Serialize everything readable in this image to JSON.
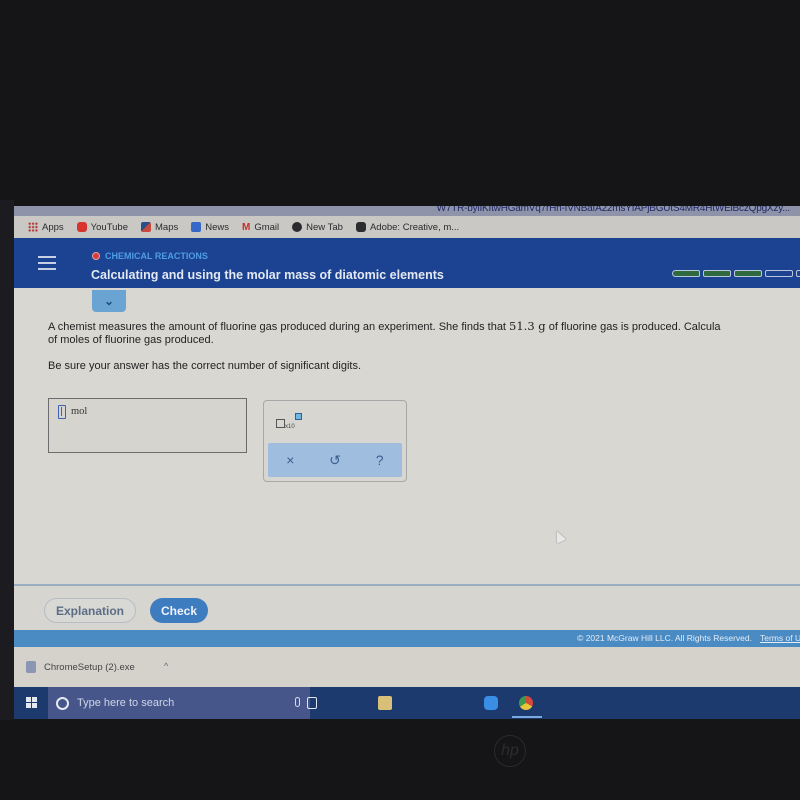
{
  "browser": {
    "url_fragment": "W7TR-bylIKItwHGamVq7rHh-IVNBafA22msYfAPjBGUtS4MR4HtWEiBczQpgXzy...",
    "bookmarks": [
      {
        "icon": "apps-grid-icon",
        "label": "Apps"
      },
      {
        "icon": "youtube-icon",
        "label": "YouTube"
      },
      {
        "icon": "maps-icon",
        "label": "Maps"
      },
      {
        "icon": "news-icon",
        "label": "News"
      },
      {
        "icon": "gmail-icon",
        "label": "Gmail"
      },
      {
        "icon": "globe-icon",
        "label": "New Tab"
      },
      {
        "icon": "adobe-icon",
        "label": "Adobe: Creative, m..."
      }
    ]
  },
  "header": {
    "topic": "CHEMICAL REACTIONS",
    "title": "Calculating and using the molar mass of diatomic elements",
    "progress": {
      "completed": 3,
      "total": 5
    }
  },
  "question": {
    "text_before": "A chemist measures the amount of fluorine gas produced during an experiment. She finds that ",
    "value": "51.3 g",
    "text_after": " of fluorine gas is produced. Calcula",
    "line2": "of moles of fluorine gas produced.",
    "hint": "Be sure your answer has the correct number of significant digits."
  },
  "answer": {
    "value": "",
    "unit": "mol"
  },
  "tools": {
    "sci_notation_label": "x10",
    "clear": "×",
    "undo": "↺",
    "help": "?"
  },
  "actions": {
    "explanation": "Explanation",
    "check": "Check"
  },
  "footer": {
    "copyright": "© 2021 McGraw Hill LLC. All Rights Reserved.",
    "terms": "Terms of U"
  },
  "downloads": {
    "file": "ChromeSetup (2).exe",
    "chevron": "^"
  },
  "taskbar": {
    "search_placeholder": "Type here to search"
  },
  "colors": {
    "header_bg": "#1b4392",
    "topic_color": "#4f9de4",
    "check_button": "#3e7cc0",
    "progress_done": "#2f6a3f",
    "footer_bg": "#4b8bc4"
  }
}
